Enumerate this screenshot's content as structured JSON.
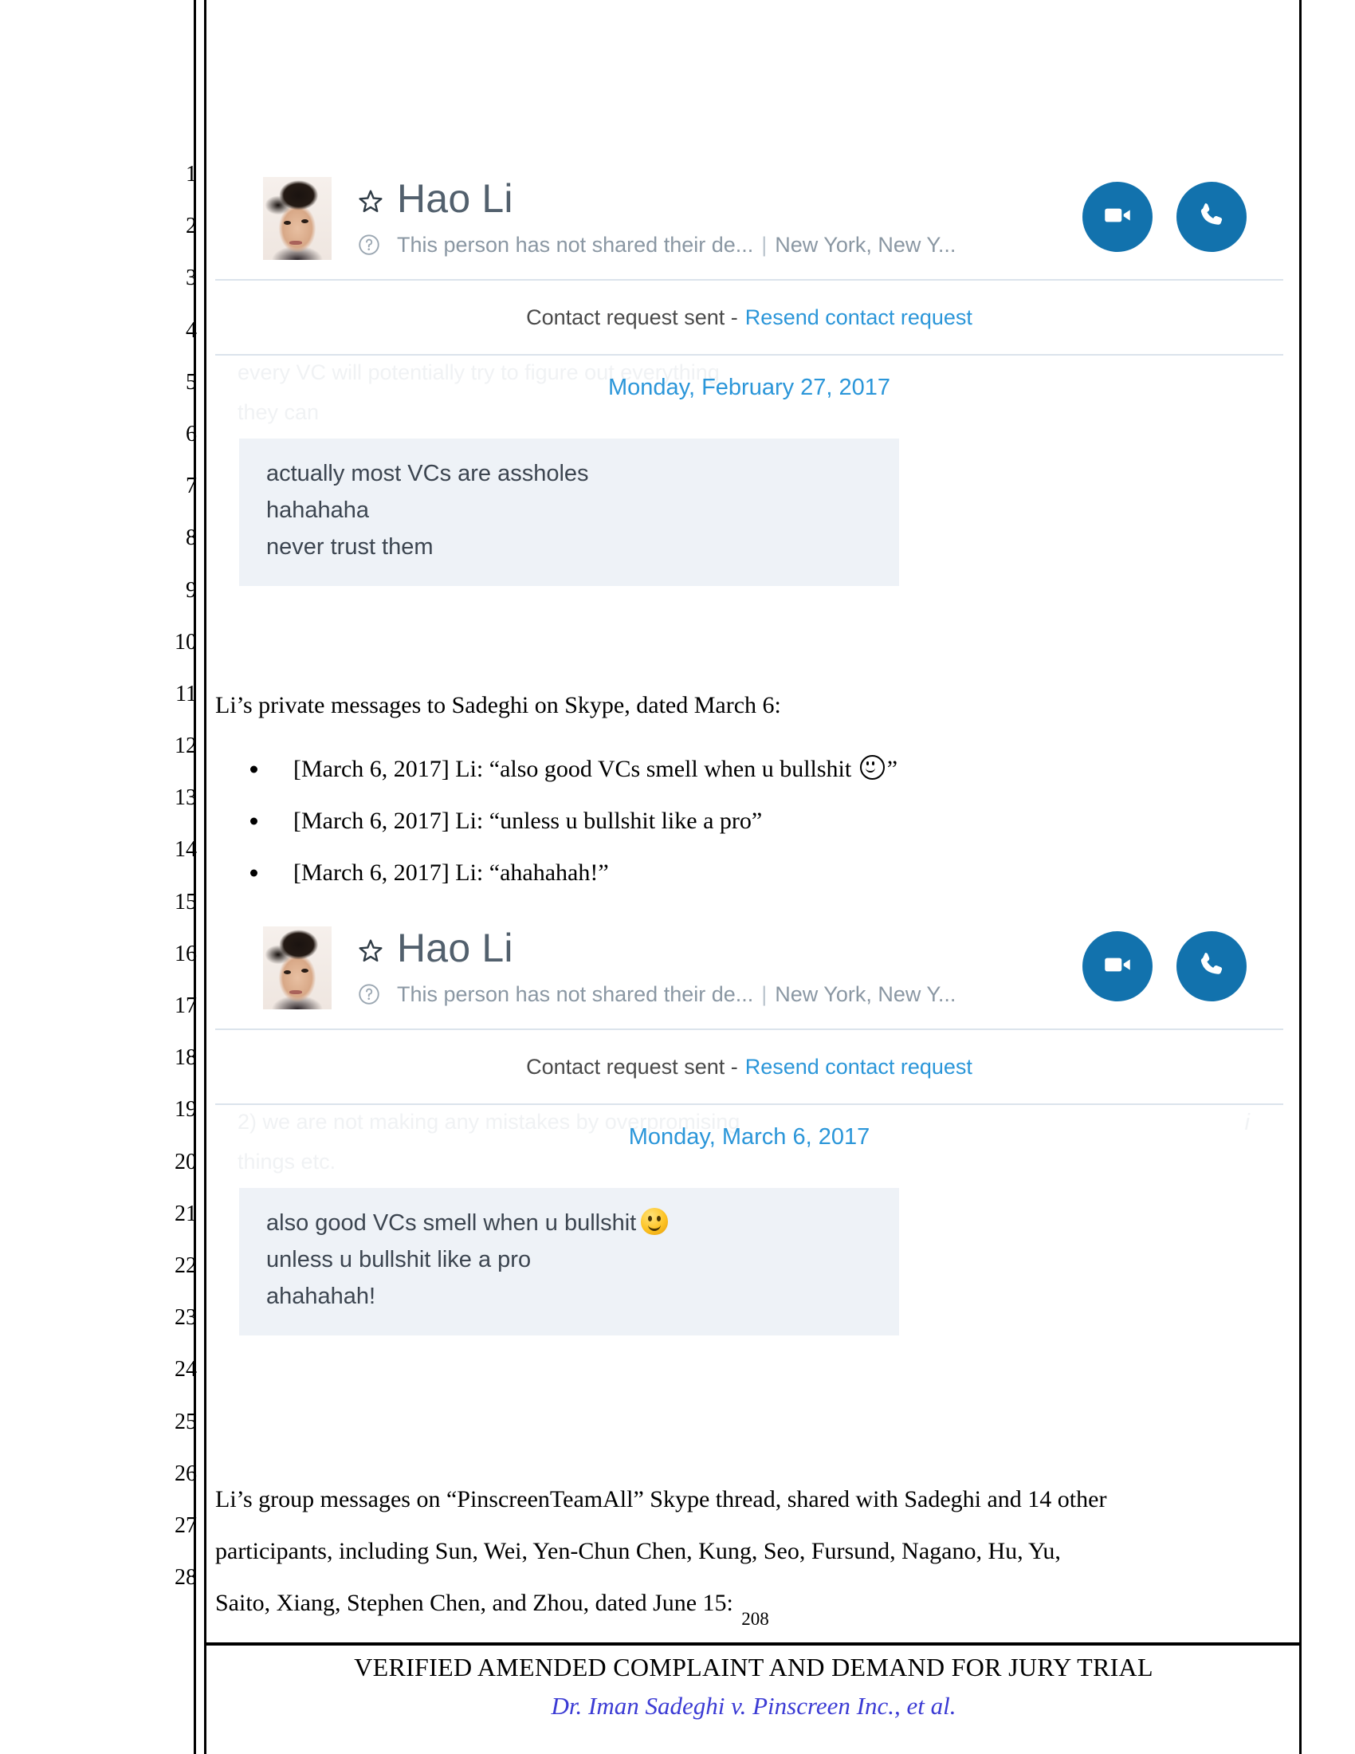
{
  "document": {
    "page_number": "208",
    "footer_title": "VERIFIED AMENDED COMPLAINT AND DEMAND FOR JURY TRIAL",
    "footer_case": "Dr. Iman Sadeghi v. Pinscreen Inc., et al.",
    "line_numbers": [
      "1",
      "2",
      "3",
      "4",
      "5",
      "6",
      "7",
      "8",
      "9",
      "10",
      "11",
      "12",
      "13",
      "14",
      "15",
      "16",
      "17",
      "18",
      "19",
      "20",
      "21",
      "22",
      "23",
      "24",
      "25",
      "26",
      "27",
      "28"
    ]
  },
  "skype_blocks": [
    {
      "contact_name": "Hao Li",
      "status_text": "This person has not shared their de...",
      "location": "New York, New Y...",
      "separator": "|",
      "star_icon": "star-icon",
      "question_icon": "question-circle-icon",
      "video_icon": "video-call-icon",
      "call_icon": "audio-call-icon",
      "request_text": "Contact request sent -",
      "request_link": "Resend contact request",
      "date_label": "Monday, February 27, 2017",
      "ghost_line_1": "every VC will potentially try to figure out everything",
      "ghost_line_2": "they can",
      "ghost_icon": "",
      "messages": [
        {
          "text": "actually most VCs are assholes",
          "emoji": false
        },
        {
          "text": "hahahaha",
          "emoji": false
        },
        {
          "text": "never trust them",
          "emoji": false
        }
      ]
    },
    {
      "contact_name": "Hao Li",
      "status_text": "This person has not shared their de...",
      "location": "New York, New Y...",
      "separator": "|",
      "star_icon": "star-icon",
      "question_icon": "question-circle-icon",
      "video_icon": "video-call-icon",
      "call_icon": "audio-call-icon",
      "request_text": "Contact request sent -",
      "request_link": "Resend contact request",
      "date_label": "Monday, March 6, 2017",
      "ghost_line_1": "2) we are not making any mistakes by overpromising",
      "ghost_line_2": "things etc.",
      "ghost_icon": "i",
      "messages": [
        {
          "text": "also good VCs smell when u bullshit",
          "emoji": true
        },
        {
          "text": "unless u bullshit like a pro",
          "emoji": false
        },
        {
          "text": "ahahahah!",
          "emoji": false
        }
      ]
    }
  ],
  "body": {
    "intro_paragraph_1": "Li’s private messages to Sadeghi on Skype, dated March 6:",
    "bullets": [
      {
        "prefix": "[March 6, 2017] Li: “also good VCs smell when u bullshit ",
        "suffix": "”",
        "has_smiley": true
      },
      {
        "prefix": "[March 6, 2017] Li: “unless u bullshit like a pro”",
        "suffix": "",
        "has_smiley": false
      },
      {
        "prefix": "[March 6, 2017] Li: “ahahahah!”",
        "suffix": "",
        "has_smiley": false
      }
    ],
    "paragraph_2_line_1": "Li’s group messages on “PinscreenTeamAll” Skype thread, shared with Sadeghi and 14 other",
    "paragraph_2_line_2": "participants, including Sun, Wei, Yen-Chun Chen, Kung, Seo, Fursund, Nagano, Hu, Yu,",
    "paragraph_2_line_3": "Saito, Xiang, Stephen Chen, and Zhou, dated June 15:"
  },
  "colors": {
    "skype_blue": "#1272ad",
    "link_blue": "#2b96d9",
    "bubble_bg": "#eef2f7",
    "case_blue": "#3b3bd4"
  }
}
